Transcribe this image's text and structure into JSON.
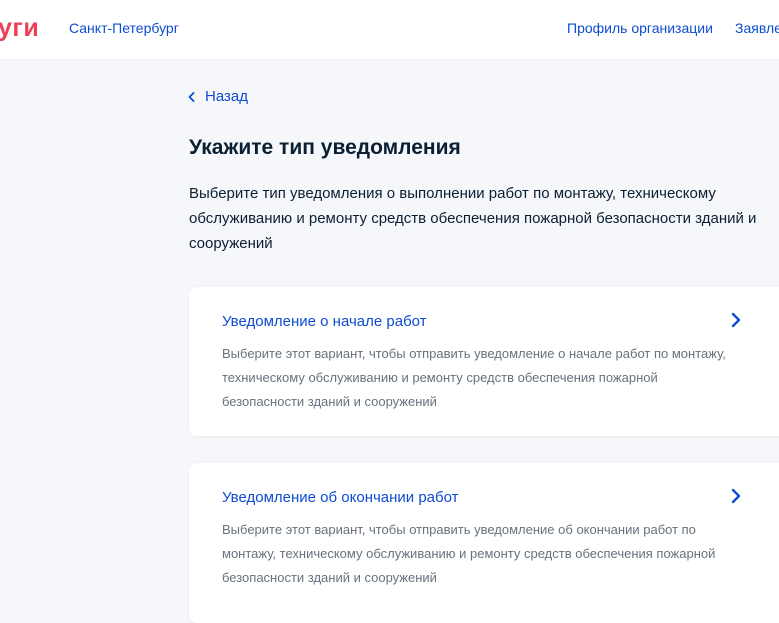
{
  "header": {
    "logo": "уги",
    "city": "Санкт-Петербург",
    "nav": {
      "profile": "Профиль организации",
      "requests": "Заявления"
    }
  },
  "back": {
    "label": "Назад"
  },
  "page": {
    "title": "Укажите тип уведомления",
    "subtitle": "Выберите тип уведомления о выполнении работ по монтажу, техническому обслуживанию и ремонту средств обеспечения пожарной безопасности зданий и сооружений"
  },
  "options": [
    {
      "title": "Уведомление о начале работ",
      "description": "Выберите этот вариант, чтобы отправить уведомление о начале работ по монтажу, техническому обслуживанию и ремонту средств обеспечения пожарной безопасности зданий и сооружений"
    },
    {
      "title": "Уведомление об окончании работ",
      "description": "Выберите этот вариант, чтобы отправить уведомление об окончании работ по монтажу, техническому обслуживанию и ремонту средств обеспечения пожарной безопасности зданий и сооружений"
    }
  ],
  "colors": {
    "link": "#0d4cd3",
    "brand": "#ee3f58",
    "text": "#0b1f33",
    "muted": "#66727f",
    "background": "#f5f7fa"
  },
  "icons": {
    "back": "chevron-left-icon",
    "option": "chevron-right-icon"
  }
}
